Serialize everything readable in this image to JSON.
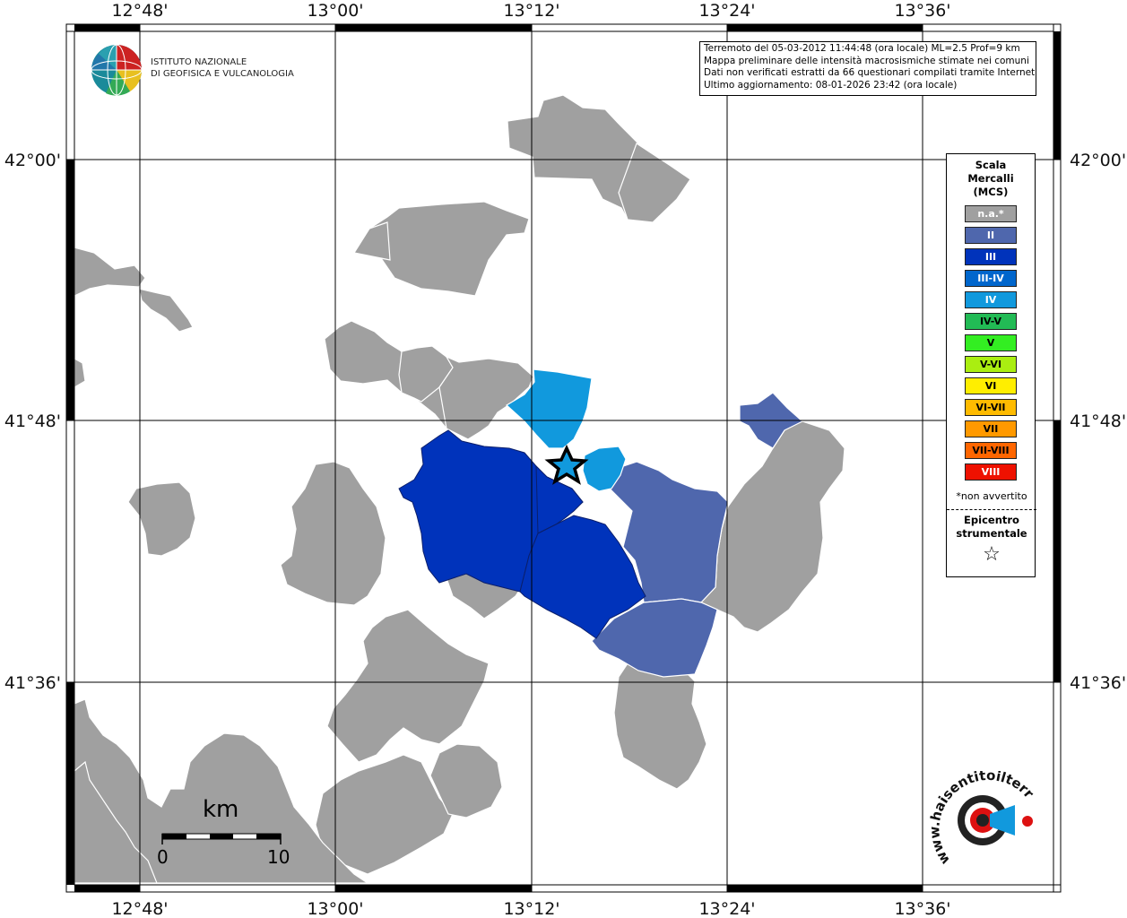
{
  "institution": {
    "name_line1": "ISTITUTO NAZIONALE",
    "name_line2": "DI GEOFISICA E VULCANOLOGIA"
  },
  "info_box": {
    "line1": "Terremoto del 05-03-2012 11:44:48 (ora locale) ML=2.5 Prof=9 km",
    "line2": "Mappa preliminare delle intensità macrosismiche stimate nei comuni",
    "line3": "Dati non verificati estratti da 66 questionari compilati tramite Internet.",
    "line4": "Ultimo aggiornamento: 08-01-2026 23:42 (ora locale)"
  },
  "axes": {
    "longitude_labels": [
      "12°48'",
      "13°00'",
      "13°12'",
      "13°24'",
      "13°36'"
    ],
    "latitude_labels": [
      "42°00'",
      "41°48'",
      "41°36'"
    ]
  },
  "legend": {
    "title_line1": "Scala",
    "title_line2": "Mercalli",
    "title_line3": "(MCS)",
    "entries": [
      {
        "label": "n.a.*",
        "color": "#a0a0a0",
        "text_color": "#ffffff"
      },
      {
        "label": "II",
        "color": "#4f67ad",
        "text_color": "#ffffff"
      },
      {
        "label": "III",
        "color": "#0033bb",
        "text_color": "#ffffff"
      },
      {
        "label": "III-IV",
        "color": "#0066cc",
        "text_color": "#ffffff"
      },
      {
        "label": "IV",
        "color": "#1199dd",
        "text_color": "#ffffff"
      },
      {
        "label": "IV-V",
        "color": "#22bb55",
        "text_color": "#000000"
      },
      {
        "label": "V",
        "color": "#33ee22",
        "text_color": "#000000"
      },
      {
        "label": "V-VI",
        "color": "#aaee11",
        "text_color": "#000000"
      },
      {
        "label": "VI",
        "color": "#ffee00",
        "text_color": "#000000"
      },
      {
        "label": "VI-VII",
        "color": "#ffbb00",
        "text_color": "#000000"
      },
      {
        "label": "VII",
        "color": "#ff9900",
        "text_color": "#000000"
      },
      {
        "label": "VII-VIII",
        "color": "#ff6600",
        "text_color": "#000000"
      },
      {
        "label": "VIII",
        "color": "#ee1100",
        "text_color": "#ffffff"
      }
    ],
    "note": "*non avvertito",
    "epicenter_line1": "Epicentro",
    "epicenter_line2": "strumentale",
    "epicenter_symbol": "☆"
  },
  "scale_bar": {
    "unit": "km",
    "start": "0",
    "end": "10"
  },
  "haisentito_logo": {
    "text": "www.haisentitoilterremoto.it"
  }
}
